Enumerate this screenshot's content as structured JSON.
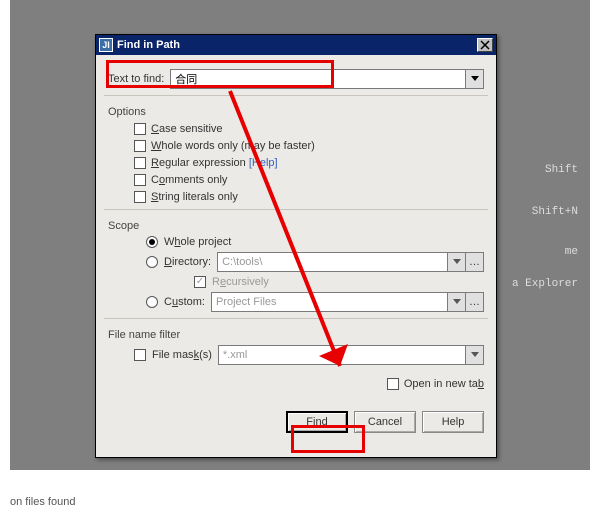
{
  "dialog": {
    "title": "Find in Path",
    "text_to_find_label": "Text to find:",
    "text_to_find_value": "合同",
    "options_label": "Options",
    "opt_case": "Case sensitive",
    "opt_whole": "Whole words only (may be faster)",
    "opt_regex": "Regular expression",
    "opt_regex_help": "[Help]",
    "opt_comments": "Comments only",
    "opt_strings": "String literals only",
    "scope_label": "Scope",
    "scope_whole": "Whole project",
    "scope_dir": "Directory:",
    "scope_dir_value": "C:\\tools\\",
    "scope_recursive": "Recursively",
    "scope_custom": "Custom:",
    "scope_custom_value": "Project Files",
    "filter_label": "File name filter",
    "filemask_label": "File mask(s)",
    "filemask_value": "*.xml",
    "open_new_tab": "Open in new tab",
    "btn_find": "Find",
    "btn_cancel": "Cancel",
    "btn_help": "Help"
  },
  "background": {
    "hint_shift": "Shift",
    "hint_shiftn": "Shift+N",
    "hint_me": "me",
    "hint_explorer": "a Explorer"
  },
  "footer": {
    "line1": "on files found"
  }
}
